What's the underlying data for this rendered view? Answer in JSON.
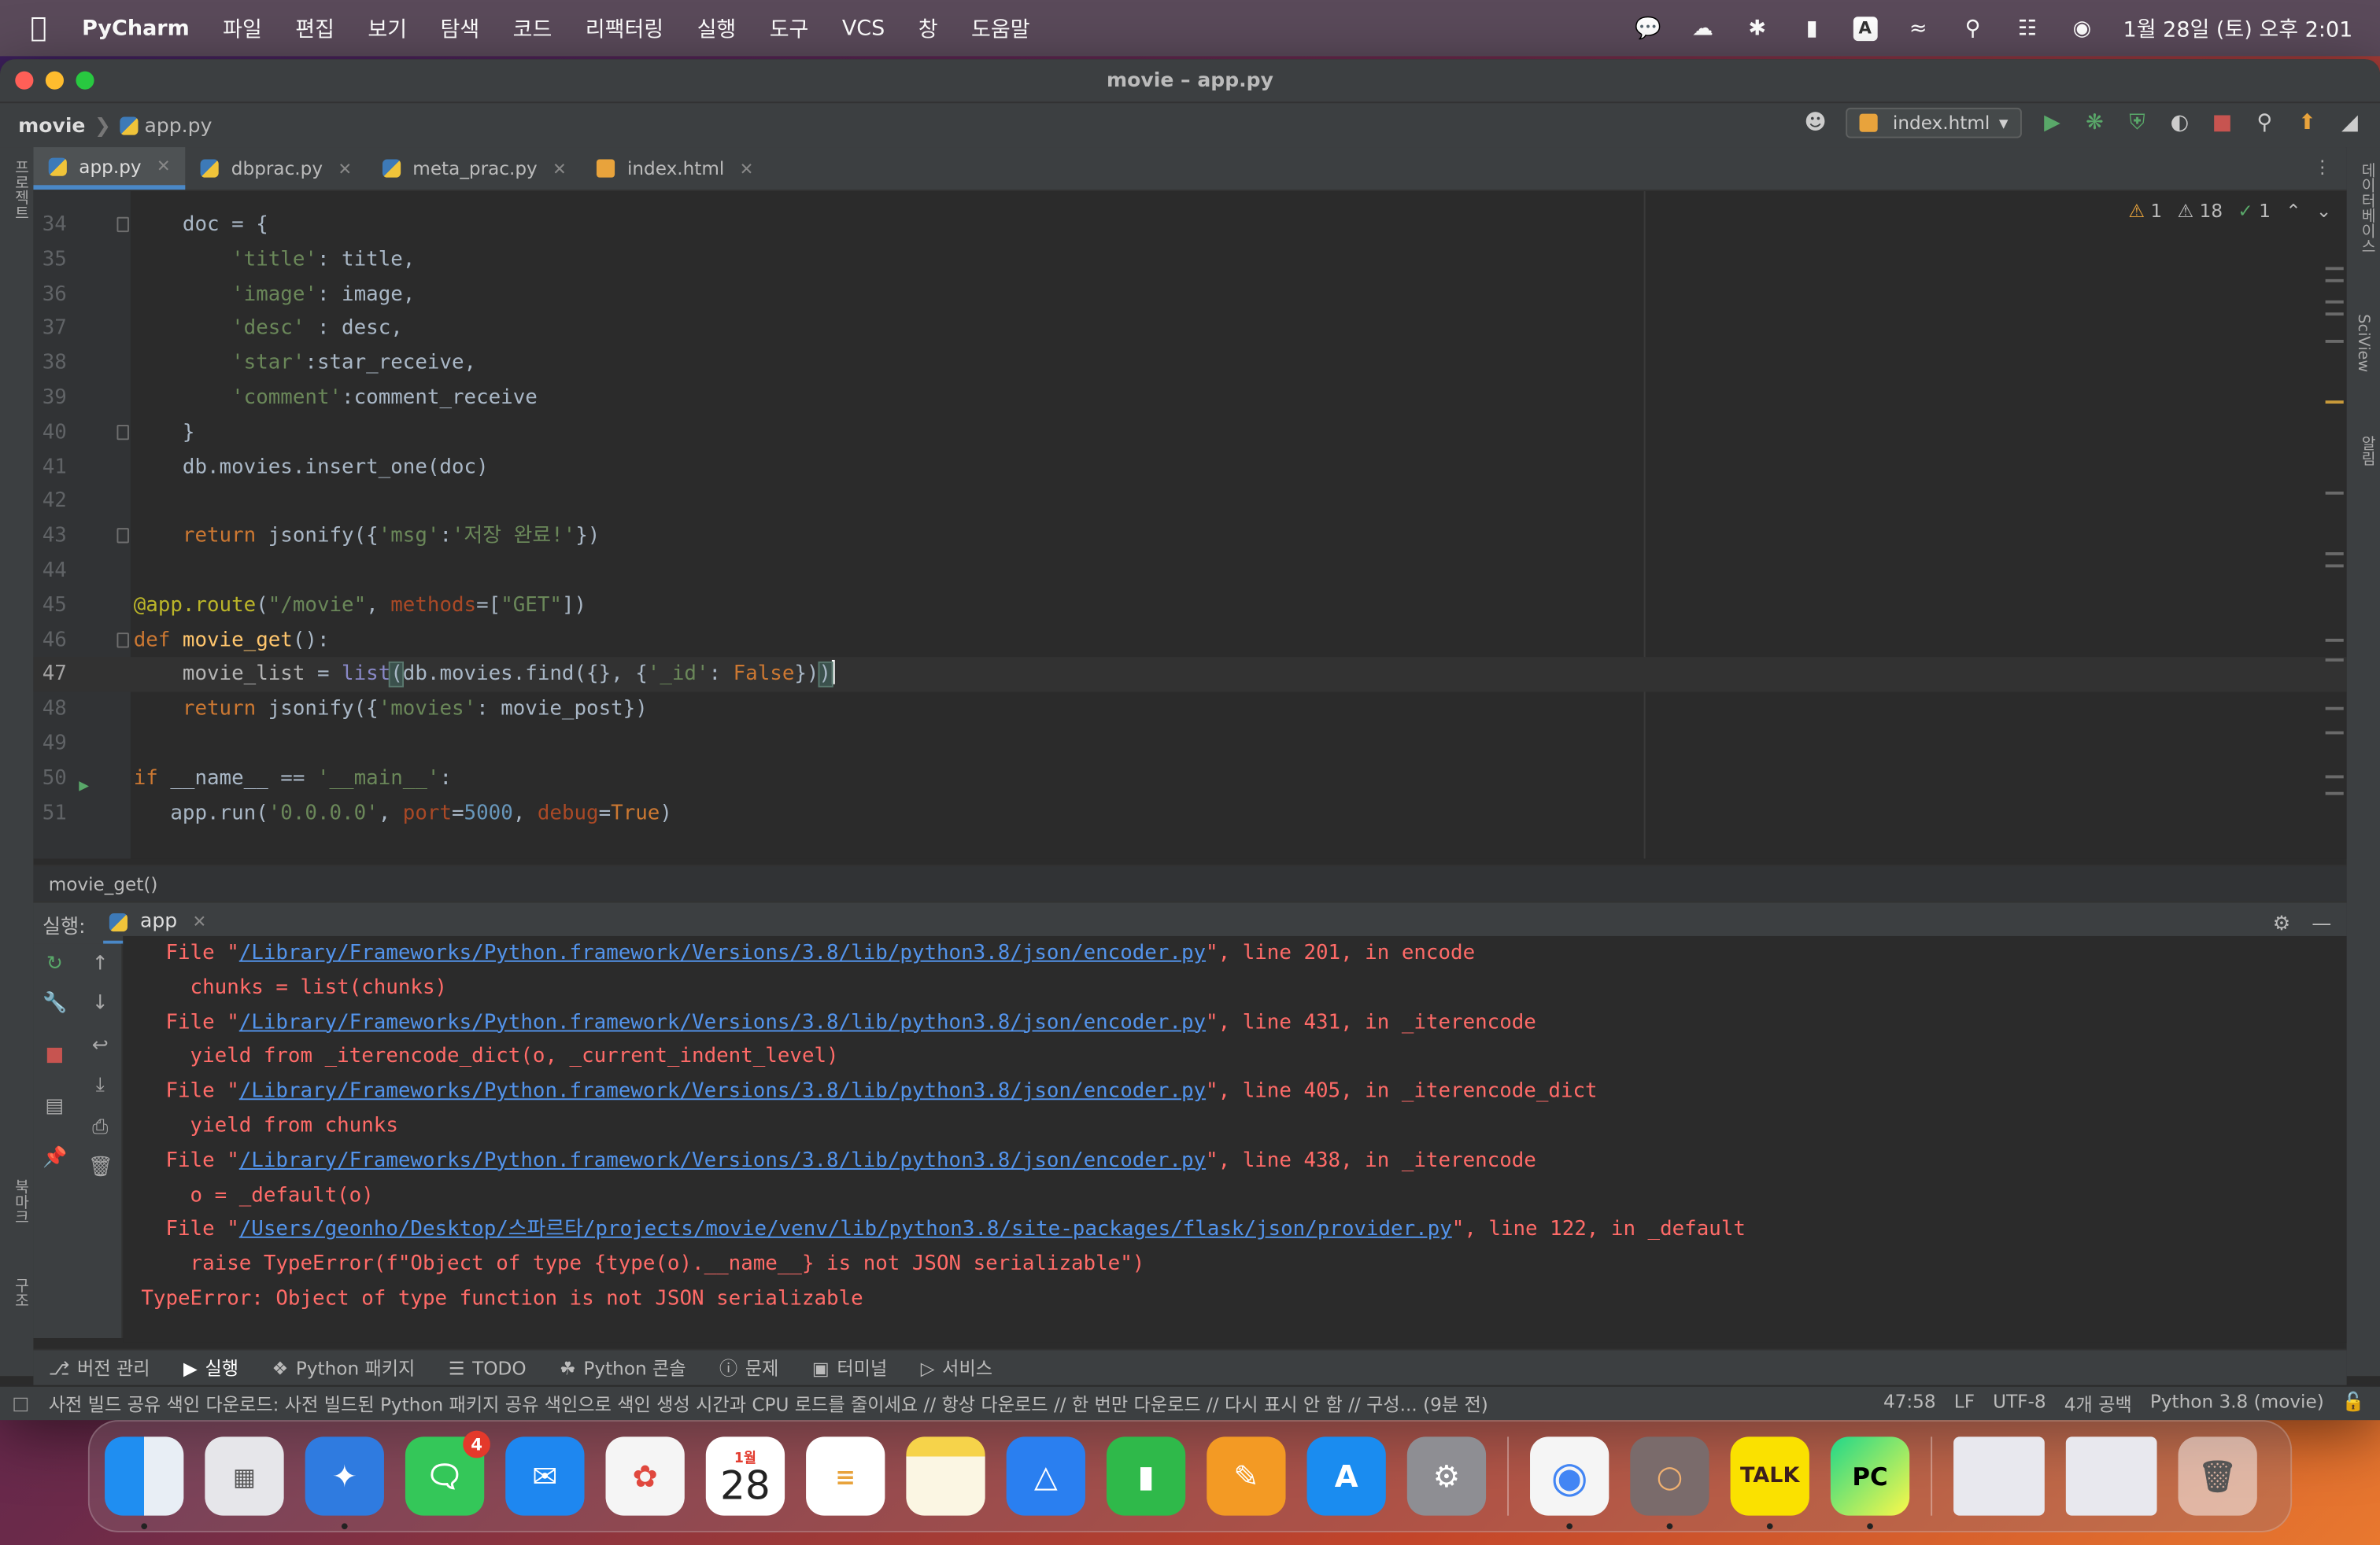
{
  "menubar": {
    "app_name": "PyCharm",
    "items": [
      "파일",
      "편집",
      "보기",
      "탐색",
      "코드",
      "리팩터링",
      "실행",
      "도구",
      "VCS",
      "창",
      "도움말"
    ],
    "clock": "1월 28일 (토) 오후 2:01",
    "input_badge": "A"
  },
  "window": {
    "title": "movie – app.py",
    "breadcrumb_project": "movie",
    "breadcrumb_file": "app.py",
    "run_config": "index.html"
  },
  "side_labels": {
    "left_top": "프로젝트",
    "left_bottom1": "북마크",
    "left_bottom2": "구조",
    "right_top": "데이터베이스",
    "right_mid": "SciView",
    "right_bottom": "알림"
  },
  "tabs": [
    {
      "label": "app.py",
      "active": true,
      "icon": "python-file-icon"
    },
    {
      "label": "dbprac.py",
      "active": false,
      "icon": "python-file-icon"
    },
    {
      "label": "meta_prac.py",
      "active": false,
      "icon": "python-file-icon"
    },
    {
      "label": "index.html",
      "active": false,
      "icon": "html-file-icon"
    }
  ],
  "inspections": {
    "warnings": "1",
    "weak_warnings": "18",
    "ok": "1"
  },
  "code_lines": [
    {
      "n": "34",
      "html": "    doc = {"
    },
    {
      "n": "35",
      "html": "        <span class='st'>'title'</span>: title,"
    },
    {
      "n": "36",
      "html": "        <span class='st'>'image'</span>: image,"
    },
    {
      "n": "37",
      "html": "        <span class='st'>'desc'</span> : desc,"
    },
    {
      "n": "38",
      "html": "        <span class='st'>'star'</span>:star_receive,"
    },
    {
      "n": "39",
      "html": "        <span class='st'>'comment'</span>:comment_receive"
    },
    {
      "n": "40",
      "html": "    }"
    },
    {
      "n": "41",
      "html": "    db.movies.insert_one(doc)"
    },
    {
      "n": "42",
      "html": ""
    },
    {
      "n": "43",
      "html": "    <span class='kw'>return</span> jsonify({<span class='st'>'msg'</span>:<span class='st'>'저장 완료!'</span>})"
    },
    {
      "n": "44",
      "html": ""
    },
    {
      "n": "45",
      "html": "<span class='dec'>@app.route</span>(<span class='st'>\"/movie\"</span>, <span class='prm'>methods</span>=[<span class='st'>\"GET\"</span>])"
    },
    {
      "n": "46",
      "html": "<span class='kw'>def</span> <span class='fn'>movie_get</span>():"
    },
    {
      "n": "47",
      "html": "    <span class='bb'>movie_list</span> = <span class='bi'>list</span><span class='hl-br'>(</span>db.movies.find({}, {<span class='st'>'_id'</span>: <span class='kw'>False</span>})<span class='hl-br'>)</span><span class='caret'></span>"
    },
    {
      "n": "48",
      "html": "    <span class='kw'>return</span> jsonify({<span class='st'>'movies'</span>: movie_post})"
    },
    {
      "n": "49",
      "html": ""
    },
    {
      "n": "50",
      "html": "<span class='kw'>if</span> __name__ == <span class='st'>'__main__'</span>:"
    },
    {
      "n": "51",
      "html": "   app.run(<span class='st'>'0.0.0.0'</span>, <span class='prm'>port</span>=<span class='num'>5000</span>, <span class='prm'>debug</span>=<span class='kw'>True</span>)"
    }
  ],
  "editor_breadcrumb": "movie_get()",
  "run_panel": {
    "label": "실행:",
    "tab": "app"
  },
  "console_lines": [
    {
      "pre": "  File \"",
      "link": "/Library/Frameworks/Python.framework/Versions/3.8/lib/python3.8/json/encoder.py",
      "post": "\", line 201, in encode"
    },
    {
      "pre": "    chunks = list(chunks)",
      "link": "",
      "post": ""
    },
    {
      "pre": "  File \"",
      "link": "/Library/Frameworks/Python.framework/Versions/3.8/lib/python3.8/json/encoder.py",
      "post": "\", line 431, in _iterencode"
    },
    {
      "pre": "    yield from _iterencode_dict(o, _current_indent_level)",
      "link": "",
      "post": ""
    },
    {
      "pre": "  File \"",
      "link": "/Library/Frameworks/Python.framework/Versions/3.8/lib/python3.8/json/encoder.py",
      "post": "\", line 405, in _iterencode_dict"
    },
    {
      "pre": "    yield from chunks",
      "link": "",
      "post": ""
    },
    {
      "pre": "  File \"",
      "link": "/Library/Frameworks/Python.framework/Versions/3.8/lib/python3.8/json/encoder.py",
      "post": "\", line 438, in _iterencode"
    },
    {
      "pre": "    o = _default(o)",
      "link": "",
      "post": ""
    },
    {
      "pre": "  File \"",
      "link": "/Users/geonho/Desktop/스파르타/projects/movie/venv/lib/python3.8/site-packages/flask/json/provider.py",
      "post": "\", line 122, in _default"
    },
    {
      "pre": "    raise TypeError(f\"Object of type {type(o).__name__} is not JSON serializable\")",
      "link": "",
      "post": ""
    },
    {
      "pre": "TypeError: Object of type function is not JSON serializable",
      "link": "",
      "post": ""
    }
  ],
  "tool_tabs": [
    {
      "label": "버전 관리",
      "icon": "branch-icon"
    },
    {
      "label": "실행",
      "icon": "play-icon",
      "active": true
    },
    {
      "label": "Python 패키지",
      "icon": "package-icon"
    },
    {
      "label": "TODO",
      "icon": "list-icon"
    },
    {
      "label": "Python 콘솔",
      "icon": "python-icon"
    },
    {
      "label": "문제",
      "icon": "problems-icon"
    },
    {
      "label": "터미널",
      "icon": "terminal-icon"
    },
    {
      "label": "서비스",
      "icon": "services-icon"
    }
  ],
  "status": {
    "message": "사전 빌드 공유 색인 다운로드: 사전 빌드된 Python 패키지 공유 색인으로 색인 생성 시간과 CPU 로드를 줄이세요 // 항상 다운로드 // 한 번만 다운로드 // 다시 표시 안 함 // 구성... (9분 전)",
    "position": "47:58",
    "line_sep": "LF",
    "encoding": "UTF-8",
    "indent": "4개 공백",
    "interpreter": "Python 3.8 (movie)"
  },
  "dock": {
    "calendar_month": "1월",
    "calendar_day": "28",
    "messages_badge": "4",
    "kakaotalk_label": "TALK",
    "pycharm_label": "PC",
    "apps": [
      "finder",
      "launchpad",
      "safari",
      "messages",
      "mail",
      "photos",
      "calendar",
      "reminders",
      "notes",
      "keynote",
      "numbers",
      "pages",
      "app-store",
      "system-settings",
      "chrome",
      "pasta-app",
      "kakaotalk",
      "pycharm"
    ]
  },
  "colors": {
    "accent": "#4a88c7",
    "error_text": "#ff6b68",
    "link": "#5394ec",
    "editor_bg": "#2b2b2b"
  }
}
